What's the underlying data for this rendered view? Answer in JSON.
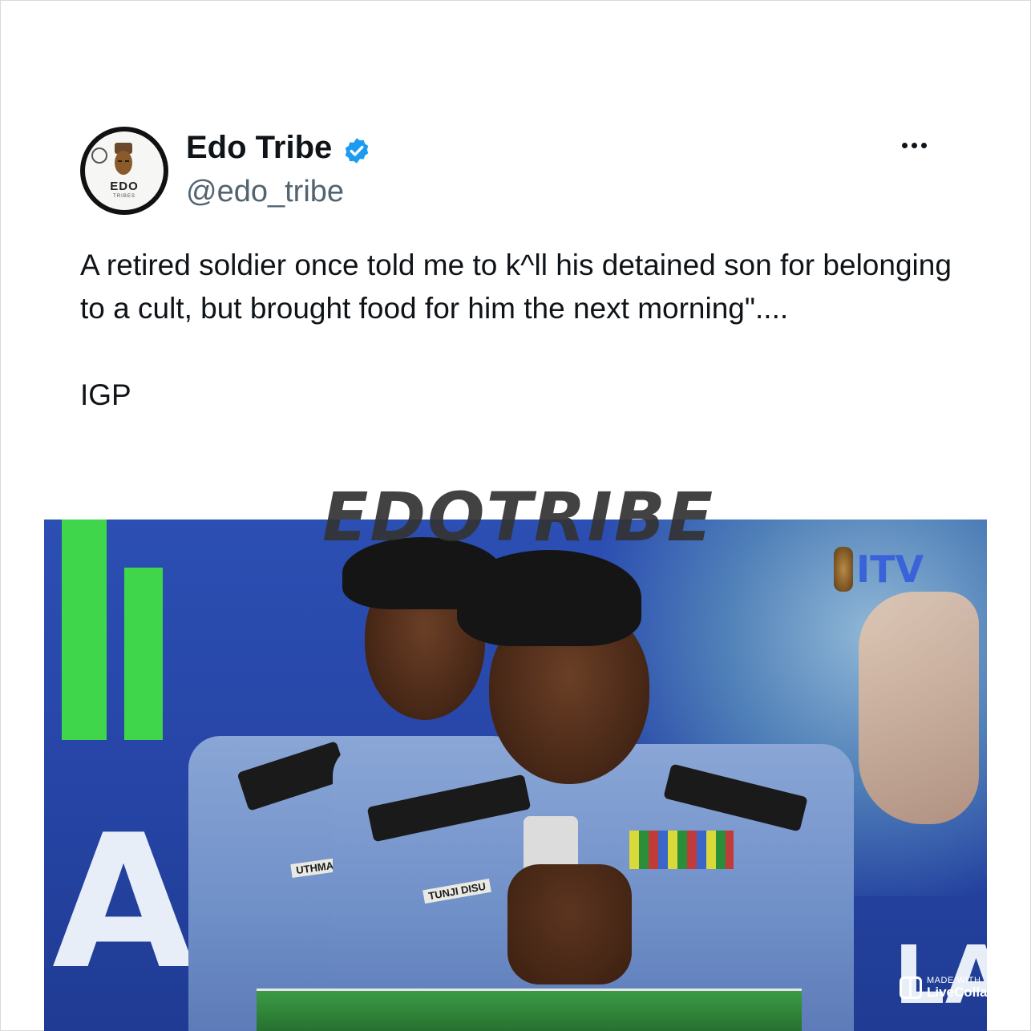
{
  "tweet": {
    "display_name": "Edo Tribe",
    "verified": true,
    "handle": "@edo_tribe",
    "text_line1": "A retired soldier once told me to k^ll his detained son for belonging to a cult, but brought food for him the next morning\"....",
    "text_line2": "IGP",
    "more_icon": "more-horizontal-icon",
    "verified_icon": "verified-badge-icon",
    "verified_color": "#1d9bf0"
  },
  "avatar": {
    "logo_text": "EDO",
    "logo_subtext": "TRIBES"
  },
  "media": {
    "watermark": "EDOTRIBE",
    "channel_logo": "ITV",
    "name_tags": [
      "UTHMAN UMA",
      "TUNJI DISU"
    ],
    "stage_text_right": "LAT"
  },
  "overlay": {
    "made_with": "MADE WITH",
    "app_name": "LiveCollage"
  }
}
